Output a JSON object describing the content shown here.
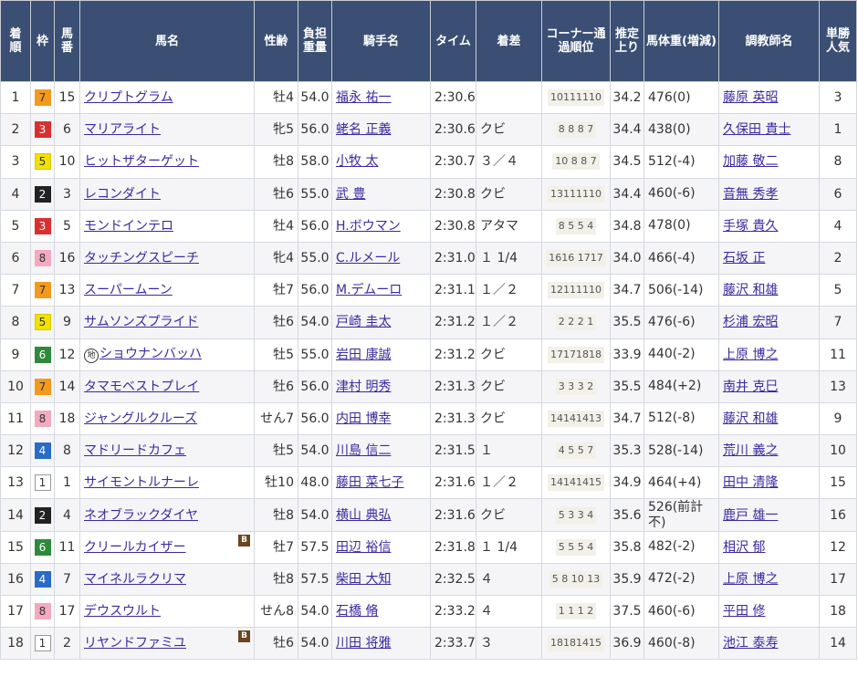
{
  "headers": [
    "着順",
    "枠",
    "馬番",
    "馬名",
    "性齢",
    "負担重量",
    "騎手名",
    "タイム",
    "着差",
    "コーナー通過順位",
    "推定上り",
    "馬体重(増減)",
    "調教師名",
    "単勝人気"
  ],
  "rows": [
    {
      "rank": "1",
      "waku": "7",
      "wakuColor": "w7",
      "num": "15",
      "horse": "クリプトグラム",
      "mark": "",
      "blinker": false,
      "sex": "牡4",
      "weight": "54.0",
      "jockey": "福永 祐一",
      "time": "2:30.6",
      "margin": "",
      "corner": "10111110",
      "last3f": "34.2",
      "bodyweight": "476(0)",
      "trainer": "藤原 英昭",
      "pop": "3"
    },
    {
      "rank": "2",
      "waku": "3",
      "wakuColor": "w3",
      "num": "6",
      "horse": "マリアライト",
      "mark": "",
      "blinker": false,
      "sex": "牝5",
      "weight": "56.0",
      "jockey": "蛯名 正義",
      "time": "2:30.6",
      "margin": "クビ",
      "corner": "8 8 8 7",
      "last3f": "34.4",
      "bodyweight": "438(0)",
      "trainer": "久保田 貴士",
      "pop": "1"
    },
    {
      "rank": "3",
      "waku": "5",
      "wakuColor": "w5",
      "num": "10",
      "horse": "ヒットザターゲット",
      "mark": "",
      "blinker": false,
      "sex": "牡8",
      "weight": "58.0",
      "jockey": "小牧 太",
      "time": "2:30.7",
      "margin": "３／４",
      "corner": "10 8 8 7",
      "last3f": "34.5",
      "bodyweight": "512(-4)",
      "trainer": "加藤 敬二",
      "pop": "8"
    },
    {
      "rank": "4",
      "waku": "2",
      "wakuColor": "w2",
      "num": "3",
      "horse": "レコンダイト",
      "mark": "",
      "blinker": false,
      "sex": "牡6",
      "weight": "55.0",
      "jockey": "武 豊",
      "time": "2:30.8",
      "margin": "クビ",
      "corner": "13111110",
      "last3f": "34.4",
      "bodyweight": "460(-6)",
      "trainer": "音無 秀孝",
      "pop": "6"
    },
    {
      "rank": "5",
      "waku": "3",
      "wakuColor": "w3",
      "num": "5",
      "horse": "モンドインテロ",
      "mark": "",
      "blinker": false,
      "sex": "牡4",
      "weight": "56.0",
      "jockey": "H.ボウマン",
      "time": "2:30.8",
      "margin": "アタマ",
      "corner": "8 5 5 4",
      "last3f": "34.8",
      "bodyweight": "478(0)",
      "trainer": "手塚 貴久",
      "pop": "4"
    },
    {
      "rank": "6",
      "waku": "8",
      "wakuColor": "w8",
      "num": "16",
      "horse": "タッチングスピーチ",
      "mark": "",
      "blinker": false,
      "sex": "牝4",
      "weight": "55.0",
      "jockey": "C.ルメール",
      "time": "2:31.0",
      "margin": "１ 1/4",
      "corner": "1616 1717",
      "last3f": "34.0",
      "bodyweight": "466(-4)",
      "trainer": "石坂 正",
      "pop": "2"
    },
    {
      "rank": "7",
      "waku": "7",
      "wakuColor": "w7",
      "num": "13",
      "horse": "スーパームーン",
      "mark": "",
      "blinker": false,
      "sex": "牡7",
      "weight": "56.0",
      "jockey": "M.デムーロ",
      "time": "2:31.1",
      "margin": "１／２",
      "corner": "12111110",
      "last3f": "34.7",
      "bodyweight": "506(-14)",
      "trainer": "藤沢 和雄",
      "pop": "5"
    },
    {
      "rank": "8",
      "waku": "5",
      "wakuColor": "w5",
      "num": "9",
      "horse": "サムソンズプライド",
      "mark": "",
      "blinker": false,
      "sex": "牡6",
      "weight": "54.0",
      "jockey": "戸崎 圭太",
      "time": "2:31.2",
      "margin": "１／２",
      "corner": "2 2 2 1",
      "last3f": "35.5",
      "bodyweight": "476(-6)",
      "trainer": "杉浦 宏昭",
      "pop": "7"
    },
    {
      "rank": "9",
      "waku": "6",
      "wakuColor": "w6",
      "num": "12",
      "horse": "ショウナンバッハ",
      "mark": "地",
      "blinker": false,
      "sex": "牡5",
      "weight": "55.0",
      "jockey": "岩田 康誠",
      "time": "2:31.2",
      "margin": "クビ",
      "corner": "17171818",
      "last3f": "33.9",
      "bodyweight": "440(-2)",
      "trainer": "上原 博之",
      "pop": "11"
    },
    {
      "rank": "10",
      "waku": "7",
      "wakuColor": "w7",
      "num": "14",
      "horse": "タマモベストプレイ",
      "mark": "",
      "blinker": false,
      "sex": "牡6",
      "weight": "56.0",
      "jockey": "津村 明秀",
      "time": "2:31.3",
      "margin": "クビ",
      "corner": "3 3 3 2",
      "last3f": "35.5",
      "bodyweight": "484(+2)",
      "trainer": "南井 克巳",
      "pop": "13"
    },
    {
      "rank": "11",
      "waku": "8",
      "wakuColor": "w8",
      "num": "18",
      "horse": "ジャングルクルーズ",
      "mark": "",
      "blinker": false,
      "sex": "せん7",
      "weight": "56.0",
      "jockey": "内田 博幸",
      "time": "2:31.3",
      "margin": "クビ",
      "corner": "14141413",
      "last3f": "34.7",
      "bodyweight": "512(-8)",
      "trainer": "藤沢 和雄",
      "pop": "9"
    },
    {
      "rank": "12",
      "waku": "4",
      "wakuColor": "w4",
      "num": "8",
      "horse": "マドリードカフェ",
      "mark": "",
      "blinker": false,
      "sex": "牡5",
      "weight": "54.0",
      "jockey": "川島 信二",
      "time": "2:31.5",
      "margin": "１",
      "corner": "4 5 5 7",
      "last3f": "35.3",
      "bodyweight": "528(-14)",
      "trainer": "荒川 義之",
      "pop": "10"
    },
    {
      "rank": "13",
      "waku": "1",
      "wakuColor": "w1",
      "num": "1",
      "horse": "サイモントルナーレ",
      "mark": "",
      "blinker": false,
      "sex": "牡10",
      "weight": "48.0",
      "jockey": "藤田 菜七子",
      "time": "2:31.6",
      "margin": "１／２",
      "corner": "14141415",
      "last3f": "34.9",
      "bodyweight": "464(+4)",
      "trainer": "田中 清隆",
      "pop": "15"
    },
    {
      "rank": "14",
      "waku": "2",
      "wakuColor": "w2",
      "num": "4",
      "horse": "ネオブラックダイヤ",
      "mark": "",
      "blinker": false,
      "sex": "牡8",
      "weight": "54.0",
      "jockey": "横山 典弘",
      "time": "2:31.6",
      "margin": "クビ",
      "corner": "5 3 3 4",
      "last3f": "35.6",
      "bodyweight": "526(前計不)",
      "trainer": "鹿戸 雄一",
      "pop": "16"
    },
    {
      "rank": "15",
      "waku": "6",
      "wakuColor": "w6",
      "num": "11",
      "horse": "クリールカイザー",
      "mark": "",
      "blinker": true,
      "sex": "牡7",
      "weight": "57.5",
      "jockey": "田辺 裕信",
      "time": "2:31.8",
      "margin": "１ 1/4",
      "corner": "5 5 5 4",
      "last3f": "35.8",
      "bodyweight": "482(-2)",
      "trainer": "相沢 郁",
      "pop": "12"
    },
    {
      "rank": "16",
      "waku": "4",
      "wakuColor": "w4",
      "num": "7",
      "horse": "マイネルラクリマ",
      "mark": "",
      "blinker": false,
      "sex": "牡8",
      "weight": "57.5",
      "jockey": "柴田 大知",
      "time": "2:32.5",
      "margin": "４",
      "corner": "5 8 10 13",
      "last3f": "35.9",
      "bodyweight": "472(-2)",
      "trainer": "上原 博之",
      "pop": "17"
    },
    {
      "rank": "17",
      "waku": "8",
      "wakuColor": "w8",
      "num": "17",
      "horse": "デウスウルト",
      "mark": "",
      "blinker": false,
      "sex": "せん8",
      "weight": "54.0",
      "jockey": "石橋 脩",
      "time": "2:33.2",
      "margin": "４",
      "corner": "1 1 1 2",
      "last3f": "37.5",
      "bodyweight": "460(-6)",
      "trainer": "平田 修",
      "pop": "18"
    },
    {
      "rank": "18",
      "waku": "1",
      "wakuColor": "w1",
      "num": "2",
      "horse": "リヤンドファミユ",
      "mark": "",
      "blinker": true,
      "sex": "牡6",
      "weight": "54.0",
      "jockey": "川田 将雅",
      "time": "2:33.7",
      "margin": "３",
      "corner": "18181415",
      "last3f": "36.9",
      "bodyweight": "460(-8)",
      "trainer": "池江 泰寿",
      "pop": "14"
    }
  ],
  "blinkerLabel": "B",
  "colors": {
    "header": "#3a4f73",
    "link": "#3a2aa0"
  }
}
